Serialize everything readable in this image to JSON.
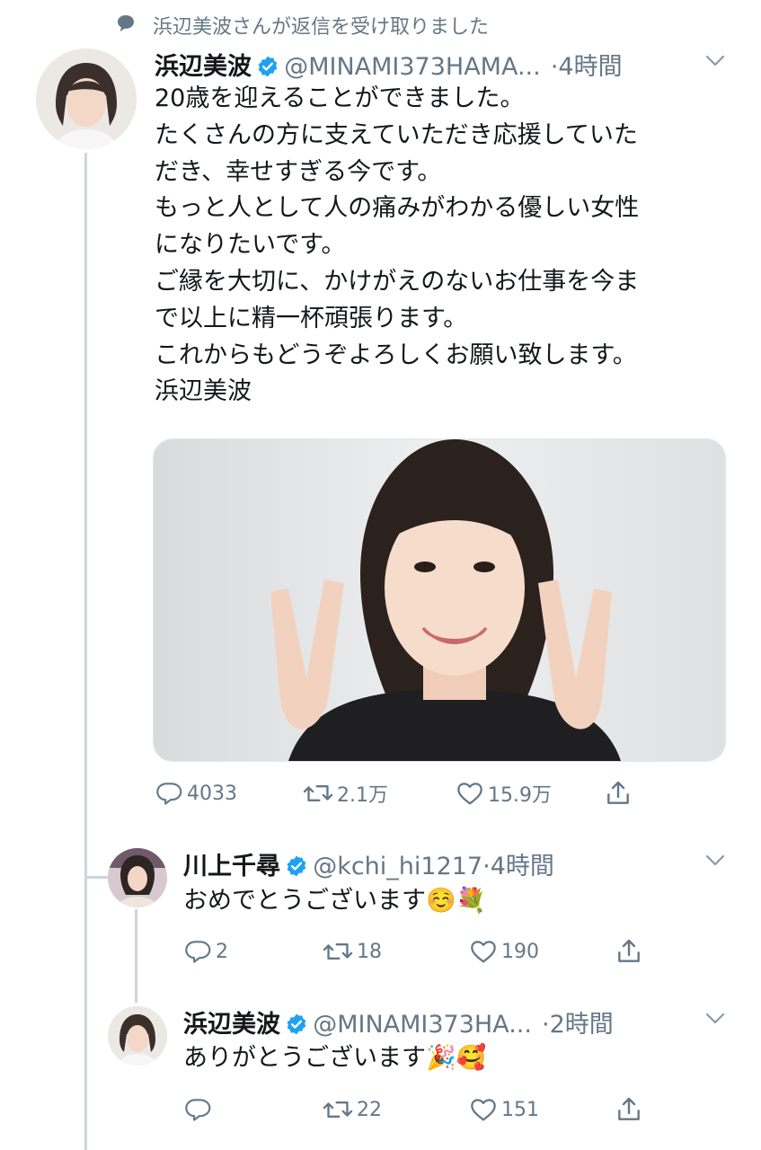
{
  "context": {
    "replied_label": "浜辺美波さんが返信を受け取りました"
  },
  "main_tweet": {
    "name": "浜辺美波",
    "handle": "@MINAMI373HAMA...",
    "time": "·4時間",
    "lines": [
      "20歳を迎えることができました。",
      "たくさんの方に支えていただき応援していた",
      "だき、幸せすぎる今です。",
      "もっと人として人の痛みがわかる優しい女性",
      "になりたいです。",
      "ご縁を大切に、かけがえのないお仕事を今ま",
      "で以上に精一杯頑張ります。",
      "これからもどうぞよろしくお願い致します。",
      "浜辺美波"
    ],
    "stats": {
      "replies": "4033",
      "retweets": "2.1万",
      "likes": "15.9万"
    }
  },
  "reply1": {
    "name": "川上千尋",
    "handle": "@kchi_hi1217",
    "time": "·4時間",
    "text": "おめでとうございます☺️💐",
    "stats": {
      "replies": "2",
      "retweets": "18",
      "likes": "190"
    }
  },
  "reply2": {
    "name": "浜辺美波",
    "handle": "@MINAMI373HA...",
    "time": "·2時間",
    "text": "ありがとうございます🎉🥰",
    "stats": {
      "replies": "",
      "retweets": "22",
      "likes": "151"
    }
  },
  "icons": [
    "speech-bubble-icon",
    "verified-badge-icon",
    "chevron-down-icon",
    "reply-icon",
    "retweet-icon",
    "like-icon",
    "share-icon"
  ],
  "colors": {
    "verified": "#1da1f2",
    "text": "#14171a",
    "secondary": "#657786",
    "thread_line": "#ccd6dd"
  }
}
